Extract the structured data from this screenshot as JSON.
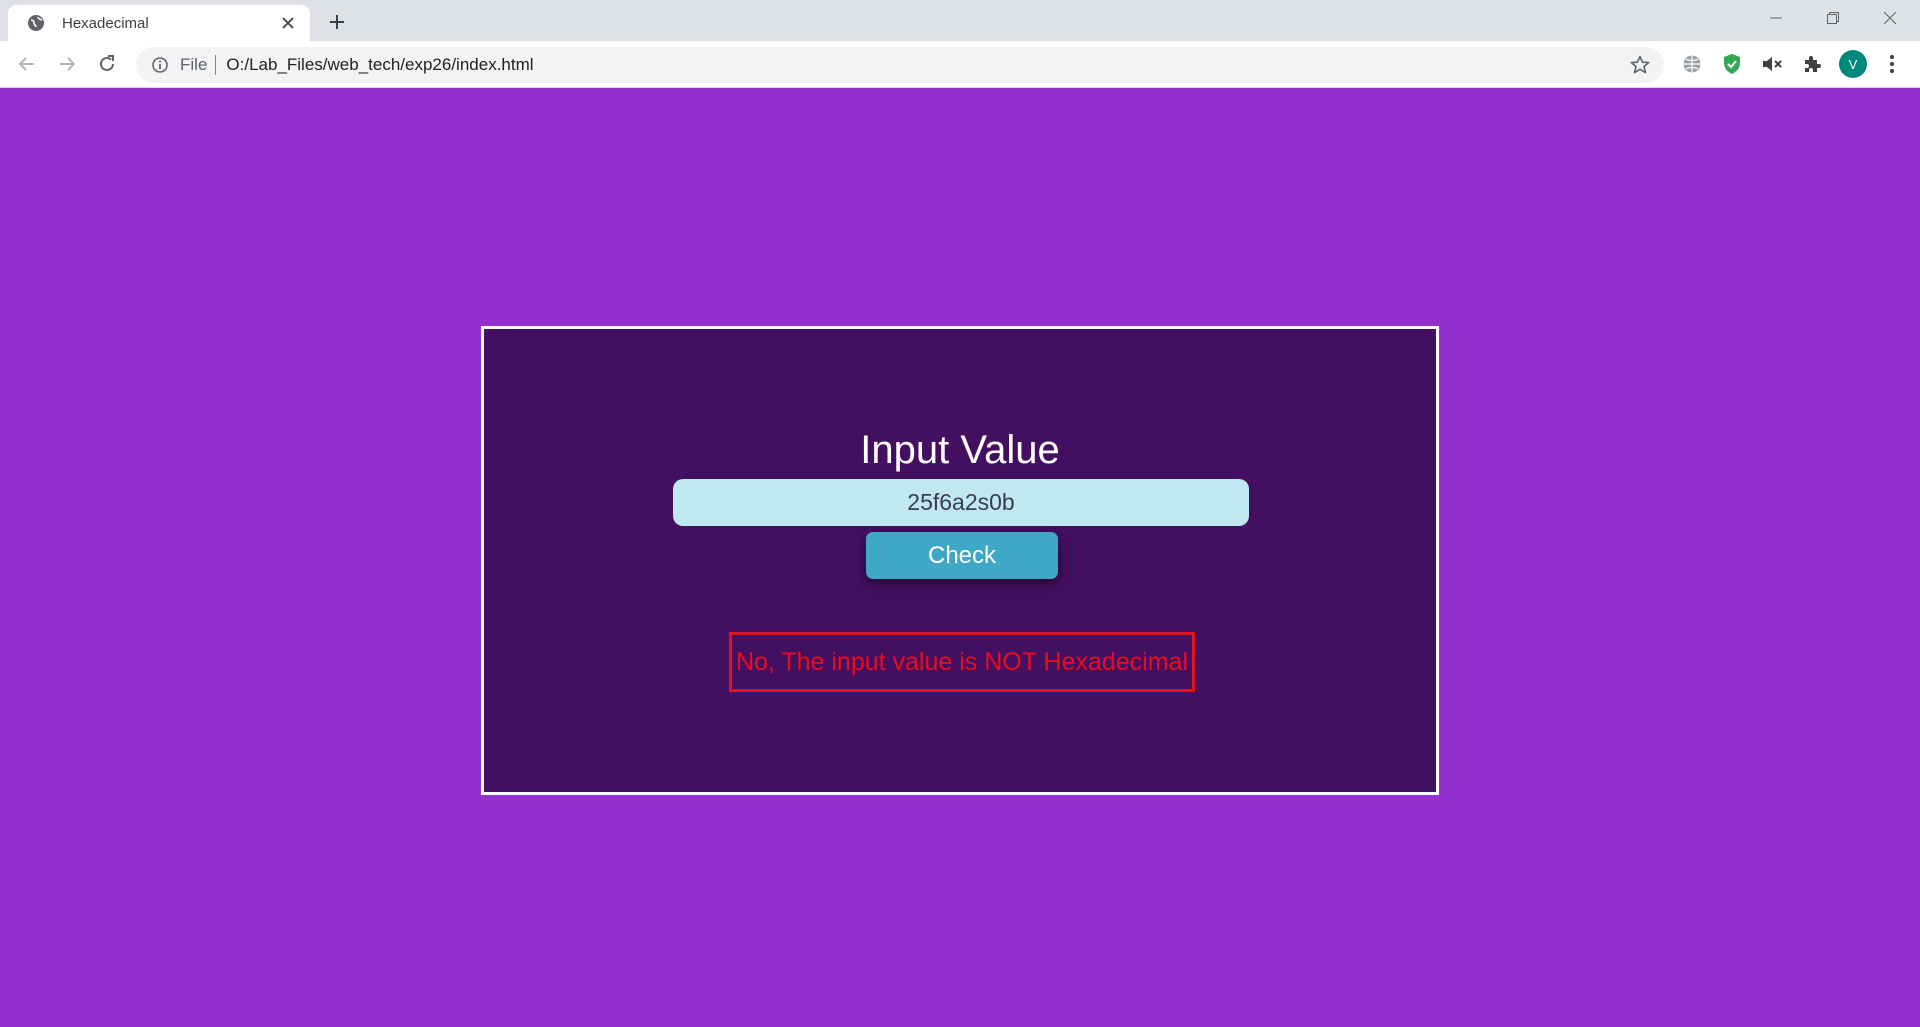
{
  "browser": {
    "tab": {
      "title": "Hexadecimal"
    },
    "address": {
      "scheme": "File",
      "url": "O:/Lab_Files/web_tech/exp26/index.html"
    },
    "profile_initial": "V"
  },
  "page": {
    "heading": "Input Value",
    "input_value": "25f6a2s0b",
    "check_label": "Check",
    "result_message": "No, The input value is NOT Hexadecimal"
  },
  "colors": {
    "page_background": "#9430cf",
    "card_background": "#430f60",
    "input_background": "#bfe8f0",
    "button_background": "#3fa8c7",
    "error_red": "#ea0c1d"
  },
  "icons": [
    "globe-icon",
    "close-icon",
    "plus-icon",
    "minimize-icon",
    "restore-icon",
    "back-icon",
    "forward-icon",
    "reload-icon",
    "info-icon",
    "star-icon",
    "translate-icon",
    "shield-icon",
    "mute-icon",
    "extensions-icon",
    "kebab-menu-icon"
  ]
}
